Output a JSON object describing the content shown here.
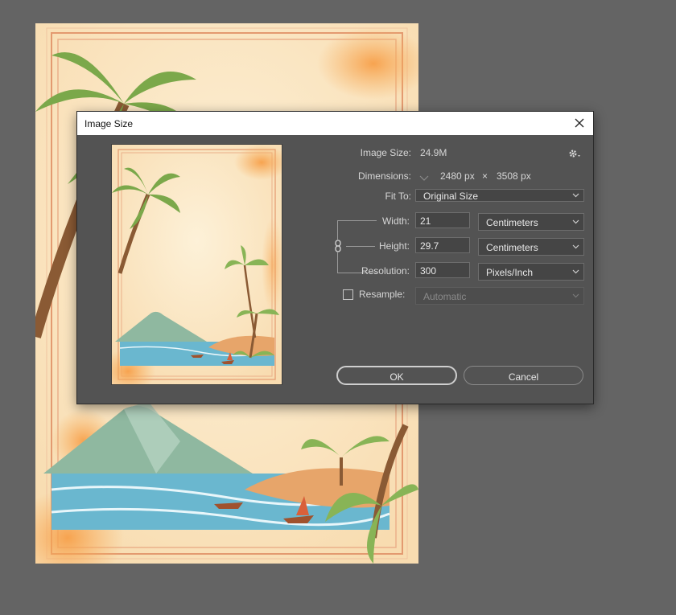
{
  "dialog": {
    "title": "Image Size",
    "image_size_label": "Image Size:",
    "image_size_value": "24.9M",
    "dimensions_label": "Dimensions:",
    "dimensions_width": "2480 px",
    "dimensions_times": "×",
    "dimensions_height": "3508 px",
    "fit_to_label": "Fit To:",
    "fit_to_value": "Original Size",
    "width_label": "Width:",
    "width_value": "21",
    "width_unit": "Centimeters",
    "height_label": "Height:",
    "height_value": "29.7",
    "height_unit": "Centimeters",
    "resolution_label": "Resolution:",
    "resolution_value": "300",
    "resolution_unit": "Pixels/Inch",
    "resample_label": "Resample:",
    "resample_checked": false,
    "resample_value": "Automatic",
    "ok_label": "OK",
    "cancel_label": "Cancel"
  },
  "icons": {
    "close": "close-icon",
    "gear": "gear-icon",
    "link": "link-icon",
    "chevron": "chevron-down-icon"
  },
  "colors": {
    "workspace_bg": "#646464",
    "dialog_bg": "#535353",
    "paper": "#fbe6c4",
    "frame": "#e0956a",
    "sea": "#5fb0c8",
    "palm": "#7ba84a"
  }
}
